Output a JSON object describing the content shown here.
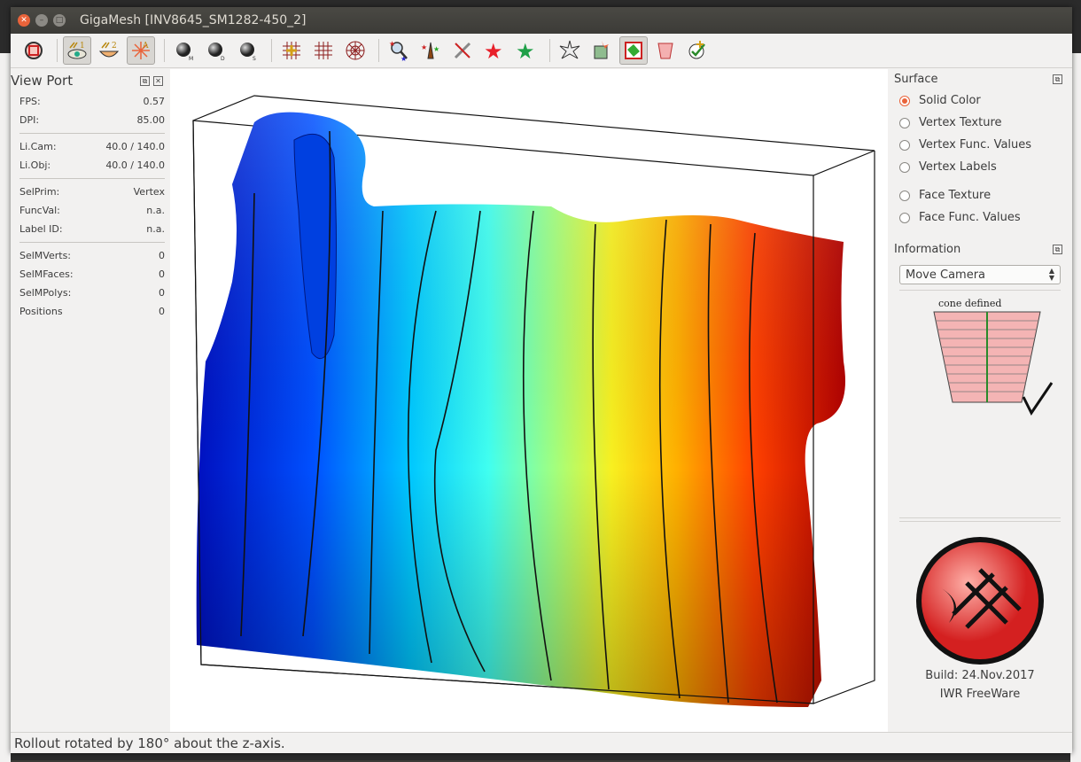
{
  "window": {
    "title": "GigaMesh [INV8645_SM1282-450_2]"
  },
  "toolbar": {
    "icons": [
      "camera-target-icon",
      "eye-1-icon",
      "bowl-2-icon",
      "star-a-icon",
      "sphere-m-icon",
      "sphere-d-icon",
      "sphere-s-icon",
      "grid-plus-icon",
      "grid-icon",
      "polar-grid-icon",
      "magnify-stars-icon",
      "figure-stars-icon",
      "pen-cross-icon",
      "red-star-icon",
      "green-star-icon",
      "burst-icon",
      "cube-burst-icon",
      "mesh-face-icon",
      "cup-icon",
      "check-plus-icon"
    ],
    "colors": {
      "accent": "#e9633a"
    }
  },
  "viewport_panel": {
    "title": "View Port",
    "stats": [
      {
        "label": "FPS:",
        "value": "0.57"
      },
      {
        "label": "DPI:",
        "value": "85.00"
      },
      {
        "label": "Li.Cam:",
        "value": "40.0 / 140.0"
      },
      {
        "label": "Li.Obj:",
        "value": "40.0 / 140.0"
      },
      {
        "label": "SelPrim:",
        "value": "Vertex"
      },
      {
        "label": "FuncVal:",
        "value": "n.a."
      },
      {
        "label": "Label ID:",
        "value": "n.a."
      },
      {
        "label": "SelMVerts:",
        "value": "0"
      },
      {
        "label": "SelMFaces:",
        "value": "0"
      },
      {
        "label": "SelMPolys:",
        "value": "0"
      },
      {
        "label": "Positions",
        "value": "0"
      }
    ]
  },
  "surface": {
    "title": "Surface",
    "options": [
      "Solid Color",
      "Vertex Texture",
      "Vertex Func. Values",
      "Vertex Labels",
      "Face Texture",
      "Face Func. Values"
    ],
    "selected": "Solid Color"
  },
  "information": {
    "title": "Information",
    "mode": "Move Camera",
    "cone_label": "cone defined",
    "build": "Build: 24.Nov.2017",
    "license": "IWR FreeWare"
  },
  "statusbar": {
    "message": "Rollout rotated by 180° about the z-axis."
  }
}
